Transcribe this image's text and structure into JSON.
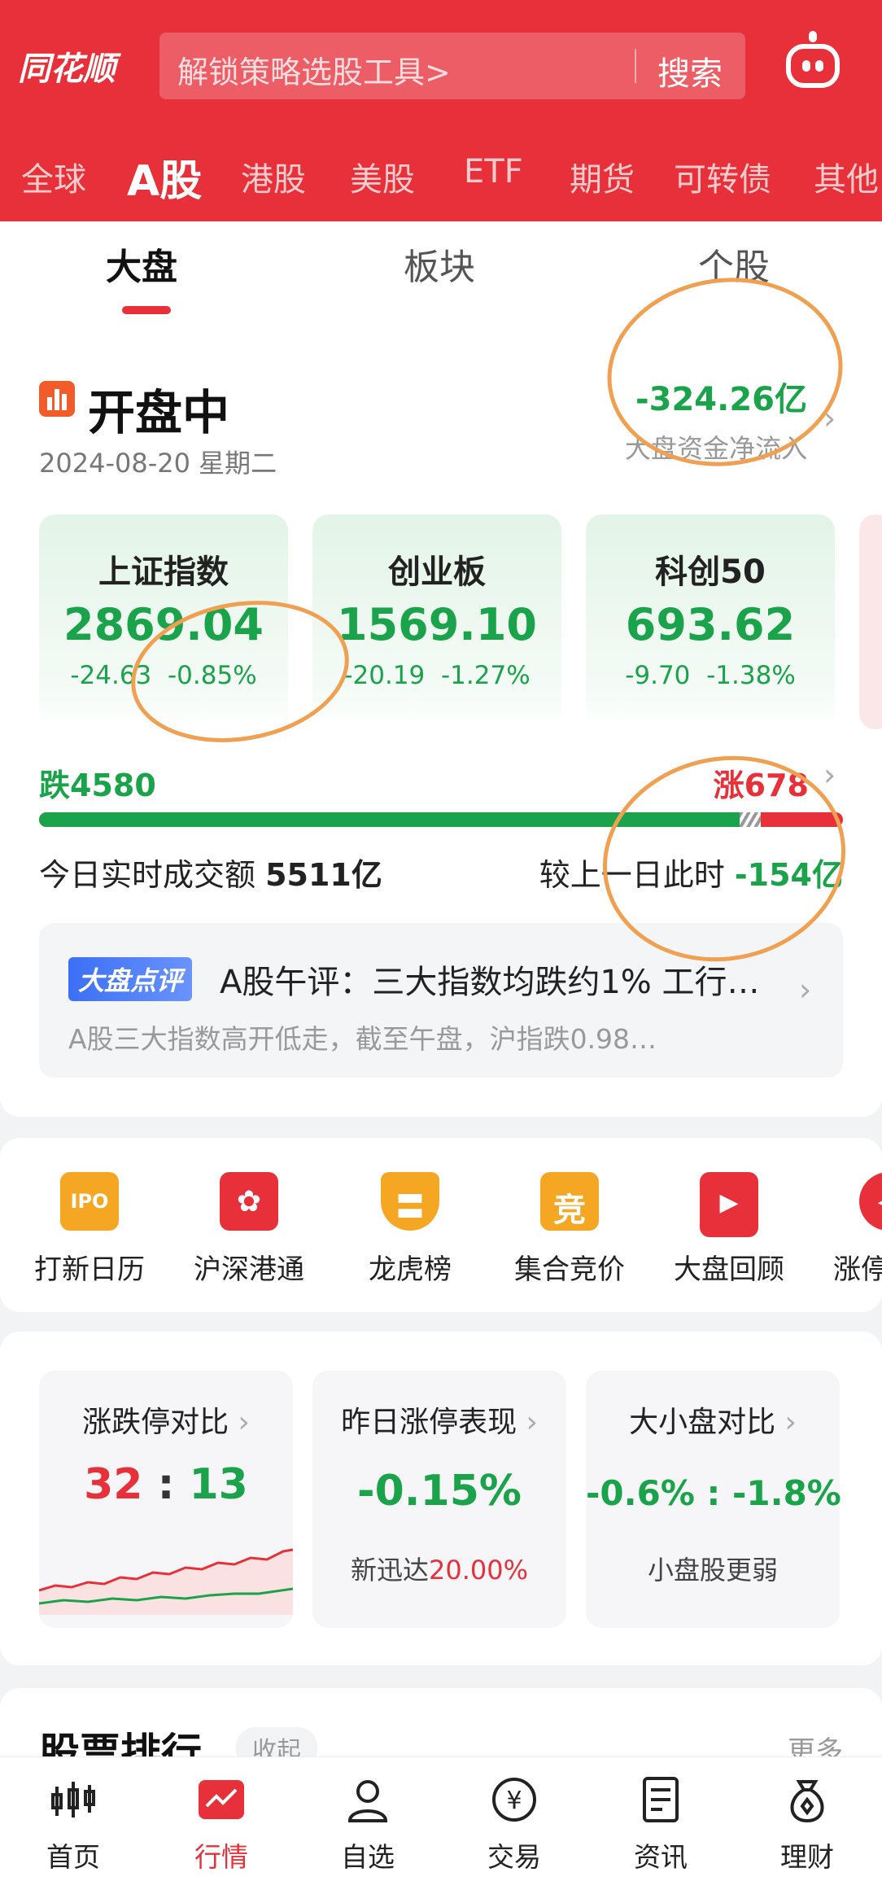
{
  "header": {
    "logo": "同花顺",
    "search_placeholder": "解锁策略选股工具>",
    "search_button": "搜索",
    "market_tabs": [
      "全球",
      "A股",
      "港股",
      "美股",
      "ETF",
      "期货",
      "可转债",
      "其他"
    ]
  },
  "sub_tabs": [
    "大盘",
    "板块",
    "个股"
  ],
  "status": {
    "title": "开盘中",
    "date": "2024-08-20 星期二",
    "net_flow_value": "-324.26亿",
    "net_flow_label": "大盘资金净流入"
  },
  "indices": [
    {
      "name": "上证指数",
      "value": "2869.04",
      "change": "-24.63",
      "pct": "-0.85%"
    },
    {
      "name": "创业板",
      "value": "1569.10",
      "change": "-20.19",
      "pct": "-1.27%"
    },
    {
      "name": "科创50",
      "value": "693.62",
      "change": "-9.70",
      "pct": "-1.38%"
    }
  ],
  "breadth": {
    "fall": "跌4580",
    "rise": "涨678",
    "fall_fraction": 0.871
  },
  "volume": {
    "label": "今日实时成交额",
    "value": "5511亿",
    "compare_label": "较上一日此时",
    "compare_value": "-154亿"
  },
  "review": {
    "badge": "大盘点评",
    "title": "A股午评：三大指数均跌约1% 工行…",
    "summary": "A股三大指数高开低走，截至午盘，沪指跌0.98…"
  },
  "tools": [
    {
      "label": "打新日历",
      "icon": "ipo-calendar-icon",
      "icon_text": "IPO"
    },
    {
      "label": "沪深港通",
      "icon": "bauhinia-icon",
      "icon_text": "✿"
    },
    {
      "label": "龙虎榜",
      "icon": "shield-icon",
      "icon_text": "〓"
    },
    {
      "label": "集合竞价",
      "icon": "auction-icon",
      "icon_text": "竞"
    },
    {
      "label": "大盘回顾",
      "icon": "market-replay-icon",
      "icon_text": "▶"
    },
    {
      "label": "涨停",
      "icon": "limit-up-icon",
      "icon_text": "◀"
    }
  ],
  "tiles": {
    "limit_compare": {
      "title": "涨跌停对比",
      "up": "32",
      "sep": ":",
      "down": "13"
    },
    "yesterday": {
      "title": "昨日涨停表现",
      "value": "-0.15%",
      "sub_label": "新迅达",
      "sub_value": "20.00%"
    },
    "cap_compare": {
      "title": "大小盘对比",
      "value": "-0.6% : -1.8%",
      "sub": "小盘股更弱"
    }
  },
  "ranking": {
    "title": "股票排行",
    "collapse": "收起",
    "more": "更多"
  },
  "bottom_nav": [
    "首页",
    "行情",
    "自选",
    "交易",
    "资讯",
    "理财"
  ],
  "colors": {
    "brand_red": "#e8303a",
    "down_green": "#1aa34a",
    "annotation_orange": "#f0a050"
  }
}
